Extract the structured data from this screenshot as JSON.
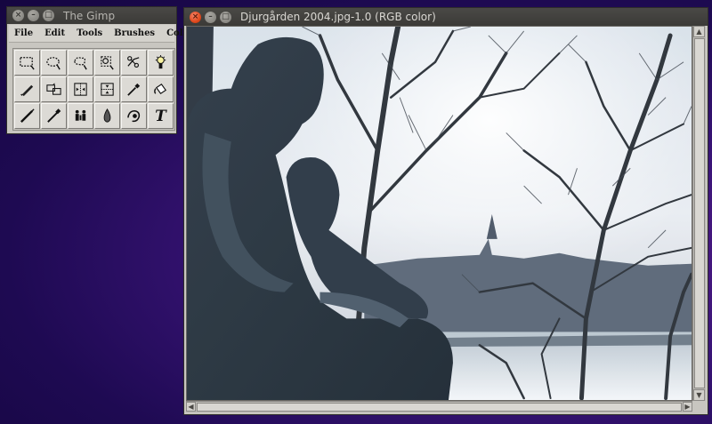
{
  "toolbox_window": {
    "title": "The Gimp",
    "controls": [
      "×",
      "–",
      "□"
    ],
    "menu": [
      "File",
      "Edit",
      "Tools",
      "Brushes",
      "Color"
    ],
    "tools": [
      {
        "name": "rect-select-icon"
      },
      {
        "name": "ellipse-select-icon"
      },
      {
        "name": "free-select-icon"
      },
      {
        "name": "bezier-select-icon"
      },
      {
        "name": "intelligent-scissors-icon"
      },
      {
        "name": "fuzzy-select-icon"
      },
      {
        "name": "pencil-move-icon"
      },
      {
        "name": "magnify-icon"
      },
      {
        "name": "flip-horizontal-icon"
      },
      {
        "name": "flip-vertical-icon"
      },
      {
        "name": "color-picker-icon"
      },
      {
        "name": "bucket-fill-icon"
      },
      {
        "name": "paintbrush-icon"
      },
      {
        "name": "airbrush-icon"
      },
      {
        "name": "clone-icon"
      },
      {
        "name": "blur-drop-icon"
      },
      {
        "name": "smudge-icon"
      },
      {
        "name": "text-icon"
      }
    ],
    "text_tool_glyph": "T"
  },
  "image_window": {
    "title": "Djurgården 2004.jpg-1.0 (RGB color)",
    "controls": [
      "×",
      "–",
      "□"
    ]
  },
  "scrollbars": {
    "up_arrow": "▲",
    "down_arrow": "▼",
    "left_arrow": "◀",
    "right_arrow": "▶"
  },
  "colors": {
    "close_active": "#e0491d",
    "titlebar": "#3c3b37",
    "desktop": "#2a0e66"
  }
}
